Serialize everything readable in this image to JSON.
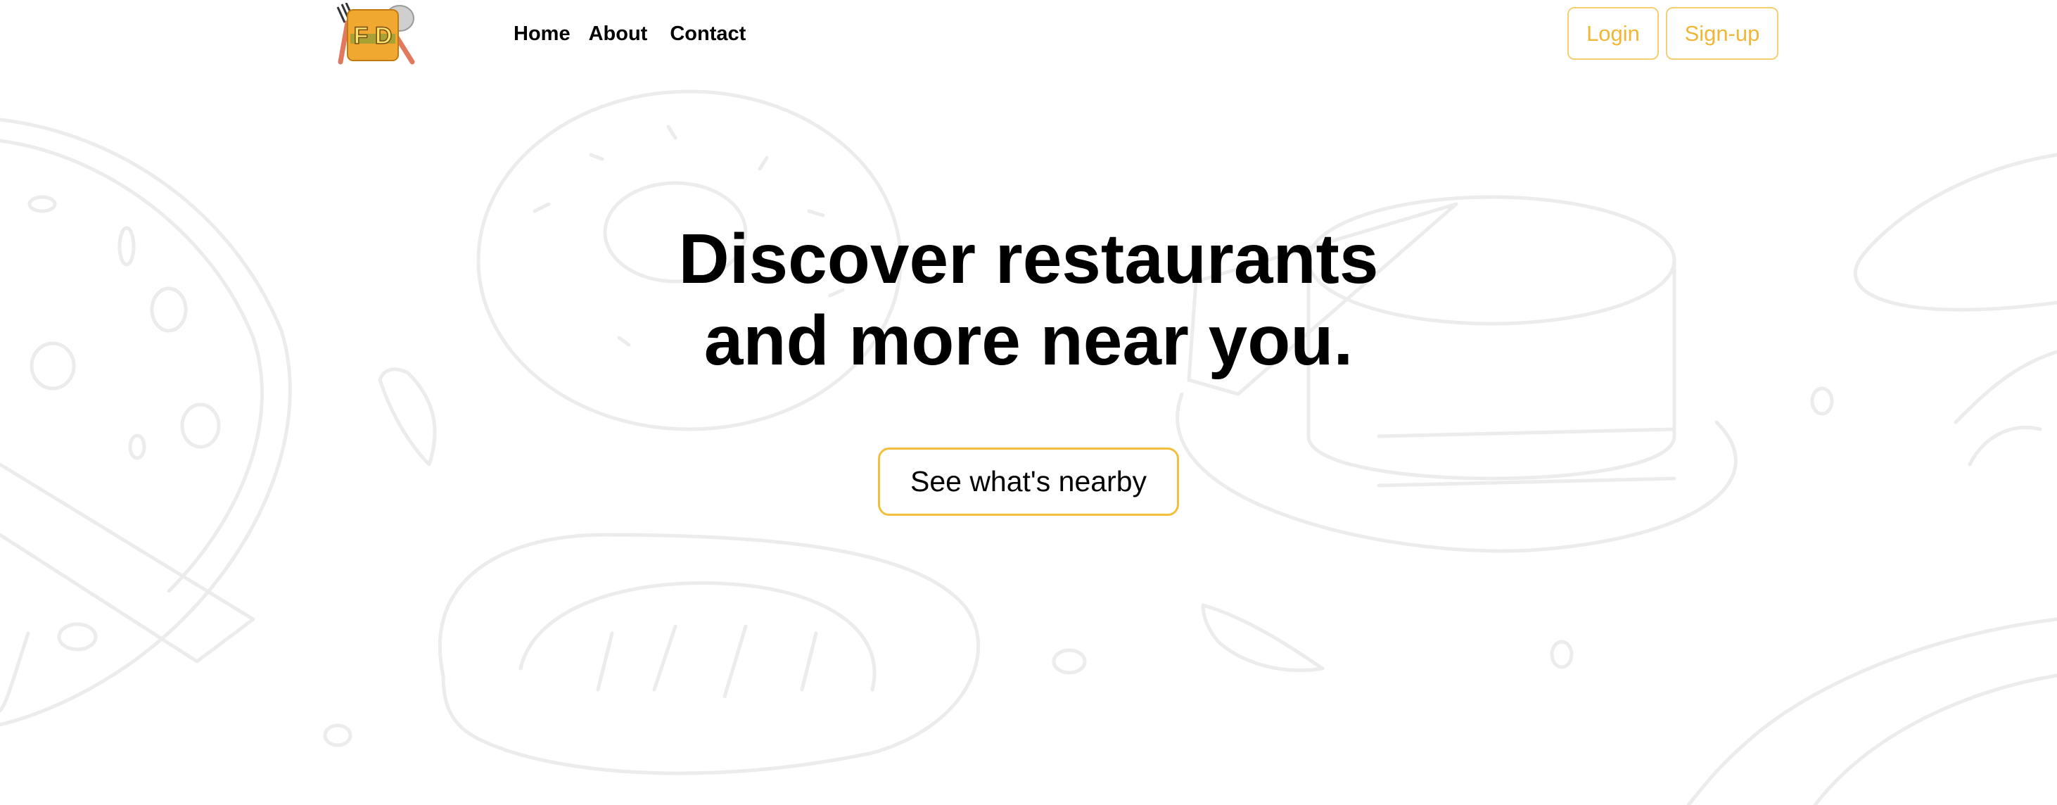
{
  "brand": {
    "logo_text": "FD",
    "logo_icon": "fork-knife-burger-logo"
  },
  "nav": {
    "home": "Home",
    "about": "About",
    "contact": "Contact"
  },
  "auth": {
    "login": "Login",
    "signup": "Sign-up"
  },
  "hero": {
    "title_line1": "Discover restaurants",
    "title_line2": "and more near you.",
    "cta": "See what's nearby"
  },
  "colors": {
    "accent": "#f0b737",
    "accent_border": "#f3be3b",
    "text": "#000000",
    "doodle": "#ececec"
  }
}
